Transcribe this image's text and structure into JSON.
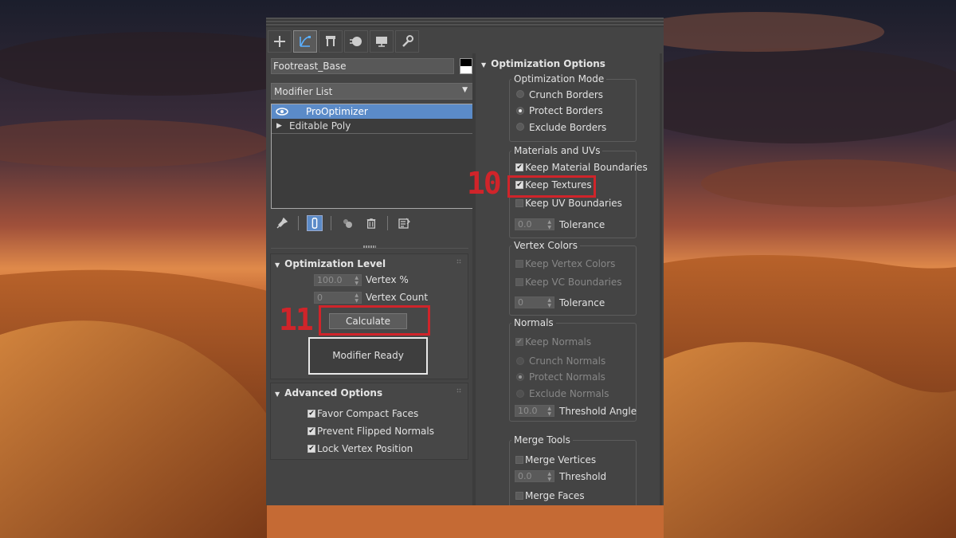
{
  "window": {
    "tabs": [
      {
        "icon": "plus-icon"
      },
      {
        "icon": "modify-icon",
        "active": true
      },
      {
        "icon": "hierarchy-icon"
      },
      {
        "icon": "motion-icon"
      },
      {
        "icon": "display-icon"
      },
      {
        "icon": "utilities-icon"
      }
    ]
  },
  "object": {
    "name": "Footreast_Base"
  },
  "modifier_list": {
    "label": "Modifier List",
    "arrow": "▼"
  },
  "stack": {
    "items": [
      {
        "label": "ProOptimizer",
        "selected": true
      },
      {
        "label": "Editable Poly",
        "expand": "▶"
      }
    ]
  },
  "optimization_level": {
    "title": "Optimization Level",
    "vertex_percent_value": "100.0",
    "vertex_percent_label": "Vertex %",
    "vertex_count_value": "0",
    "vertex_count_label": "Vertex Count",
    "calculate_label": "Calculate",
    "status": "Modifier Ready"
  },
  "advanced_options": {
    "title": "Advanced Options",
    "items": [
      {
        "label": "Favor Compact Faces",
        "checked": true
      },
      {
        "label": "Prevent Flipped Normals",
        "checked": true
      },
      {
        "label": "Lock Vertex Position",
        "checked": true
      }
    ]
  },
  "optimization_options": {
    "title": "Optimization Options",
    "mode": {
      "title": "Optimization Mode",
      "options": [
        {
          "label": "Crunch Borders",
          "selected": false
        },
        {
          "label": "Protect Borders",
          "selected": true
        },
        {
          "label": "Exclude Borders",
          "selected": false
        }
      ]
    },
    "materials": {
      "title": "Materials and UVs",
      "keep_material": "Keep Material Boundaries",
      "keep_textures": "Keep Textures",
      "keep_uv": "Keep UV Boundaries",
      "tolerance_value": "0.0",
      "tolerance_label": "Tolerance"
    },
    "vertex_colors": {
      "title": "Vertex Colors",
      "keep_vc": "Keep Vertex Colors",
      "keep_vc_boundaries": "Keep VC Boundaries",
      "tolerance_value": "0",
      "tolerance_label": "Tolerance"
    },
    "normals": {
      "title": "Normals",
      "keep_normals": "Keep Normals",
      "options": [
        {
          "label": "Crunch Normals",
          "selected": false
        },
        {
          "label": "Protect Normals",
          "selected": true
        },
        {
          "label": "Exclude Normals",
          "selected": false
        }
      ],
      "threshold_value": "10.0",
      "threshold_label": "Threshold Angle"
    },
    "merge_tools": {
      "title": "Merge Tools",
      "merge_vertices": "Merge Vertices",
      "threshold_value": "0.0",
      "threshold_label": "Threshold",
      "merge_faces": "Merge Faces"
    }
  },
  "annotations": {
    "step_10": "10",
    "step_11": "11",
    "highlight_color": "#d0242a"
  },
  "checkmark": "✔"
}
